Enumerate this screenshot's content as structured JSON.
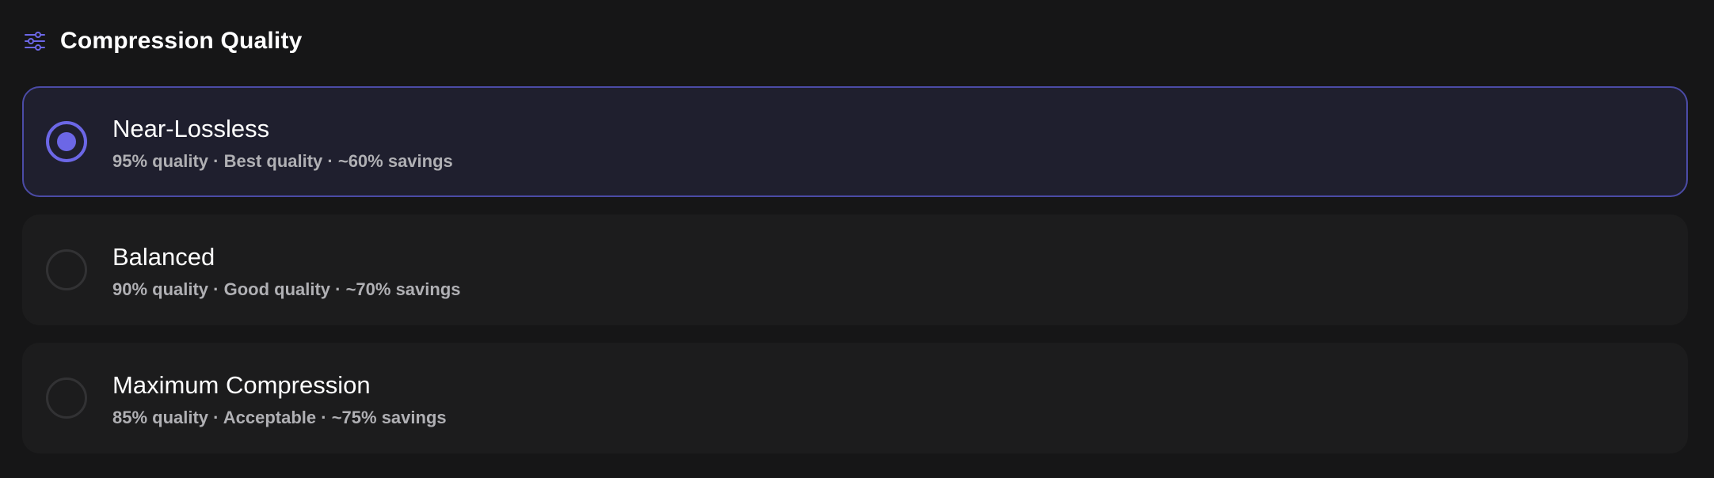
{
  "section": {
    "title": "Compression Quality",
    "icon": "sliders-icon"
  },
  "colors": {
    "accent": "#6c67e6",
    "selected_border": "#4b4ba6",
    "selected_bg": "#1f1f2e",
    "card_bg": "#1c1c1d",
    "page_bg": "#161617",
    "subtitle": "#b0b0b4"
  },
  "options": [
    {
      "title": "Near-Lossless",
      "subtitle": "95% quality · Best quality · ~60% savings",
      "selected": true
    },
    {
      "title": "Balanced",
      "subtitle": "90% quality · Good quality · ~70% savings",
      "selected": false
    },
    {
      "title": "Maximum Compression",
      "subtitle": "85% quality · Acceptable · ~75% savings",
      "selected": false
    }
  ]
}
